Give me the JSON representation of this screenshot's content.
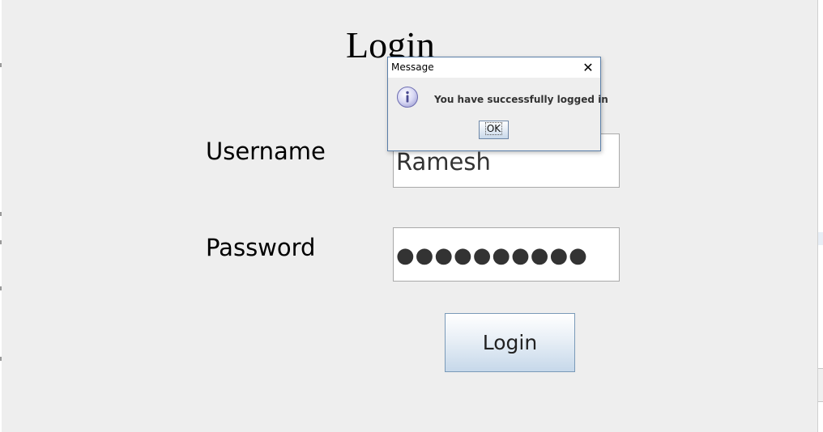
{
  "form": {
    "title": "Login",
    "username_label": "Username",
    "password_label": "Password",
    "username_value": "Ramesh",
    "password_value": "●●●●●●●●●●",
    "login_button_label": "Login"
  },
  "dialog": {
    "title": "Message",
    "close_glyph": "✕",
    "message": "You have successfully logged in",
    "ok_label": "OK",
    "icon": "info-icon"
  },
  "colors": {
    "window_bg": "#eeeeee",
    "dialog_border": "#5a7ea8",
    "button_gradient_end": "#c6d8ea"
  }
}
